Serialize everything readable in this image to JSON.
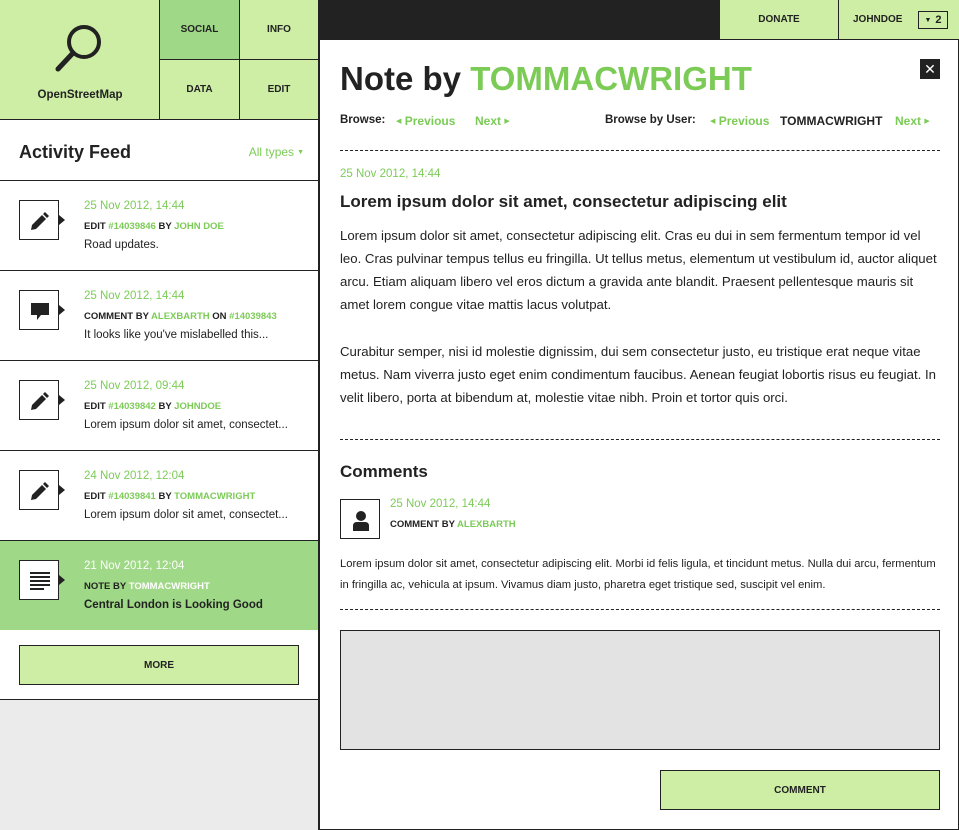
{
  "app": {
    "name": "OpenStreetMap"
  },
  "nav": {
    "social": "SOCIAL",
    "info": "INFO",
    "data": "DATA",
    "edit": "EDIT"
  },
  "topbar": {
    "donate": "DONATE",
    "user": "JOHNDOE",
    "count": "2"
  },
  "feed": {
    "title": "Activity Feed",
    "filter": "All types",
    "items": [
      {
        "icon": "pencil-icon",
        "time": "25 Nov 2012, 14:44",
        "action": "EDIT",
        "ref": "#14039846",
        "by": "BY",
        "user": "JOHN DOE",
        "desc": "Road updates."
      },
      {
        "icon": "comment-icon",
        "time": "25 Nov 2012, 14:44",
        "action": "COMMENT BY",
        "user": "ALEXBARTH",
        "on": "ON",
        "ref": "#14039843",
        "desc": "It looks like you've mislabelled this..."
      },
      {
        "icon": "pencil-icon",
        "time": "25 Nov 2012, 09:44",
        "action": "EDIT",
        "ref": "#14039842",
        "by": "BY",
        "user": "JOHNDOE",
        "desc": "Lorem ipsum dolor sit amet, consectet..."
      },
      {
        "icon": "pencil-icon",
        "time": "24 Nov 2012, 12:04",
        "action": "EDIT",
        "ref": "#14039841",
        "by": "BY",
        "user": "TOMMACWRIGHT",
        "desc": "Lorem ipsum dolor sit amet, consectet..."
      },
      {
        "icon": "note-icon",
        "time": "21 Nov 2012, 12:04",
        "action": "NOTE BY",
        "user": "TOMMACWRIGHT",
        "desc": "Central London is Looking Good"
      }
    ],
    "more": "MORE"
  },
  "note": {
    "title_prefix": "Note by",
    "title_user": "TOMMACWRIGHT",
    "browse_label": "Browse:",
    "previous": "Previous",
    "next": "Next",
    "browse_user_label": "Browse by User:",
    "browse_user_name": "TOMMACWRIGHT",
    "time": "25 Nov 2012, 14:44",
    "heading": "Lorem ipsum dolor sit amet, consectetur adipiscing elit",
    "paragraphs": [
      "Lorem ipsum dolor sit amet, consectetur adipiscing elit. Cras eu dui in sem fermentum tempor id vel leo. Cras pulvinar tempus tellus eu fringilla. Ut tellus metus, elementum ut vestibulum id, auctor aliquet arcu. Etiam aliquam libero vel eros dictum a gravida ante blandit. Praesent pellentesque mauris sit amet lorem congue vitae mattis lacus volutpat.",
      "Curabitur semper, nisi id molestie dignissim, dui sem consectetur justo, eu tristique erat neque vitae metus. Nam viverra justo eget enim condimentum faucibus. Aenean feugiat lobortis risus eu feugiat. In velit libero, porta at bibendum at, molestie vitae nibh. Proin et tortor quis orci."
    ]
  },
  "comments": {
    "title": "Comments",
    "items": [
      {
        "time": "25 Nov 2012, 14:44",
        "action": "COMMENT BY",
        "user": "ALEXBARTH",
        "text": "Lorem ipsum dolor sit amet, consectetur adipiscing elit. Morbi id felis ligula, et tincidunt metus. Nulla dui arcu, fermentum in fringilla ac, vehicula at ipsum. Vivamus diam justo, pharetra eget tristique sed, suscipit vel enim."
      }
    ],
    "input_value": "",
    "submit": "COMMENT"
  },
  "colors": {
    "accent": "#7ccb57",
    "light_green": "#cdeea4",
    "active_green": "#9fd886",
    "dark": "#222222"
  }
}
